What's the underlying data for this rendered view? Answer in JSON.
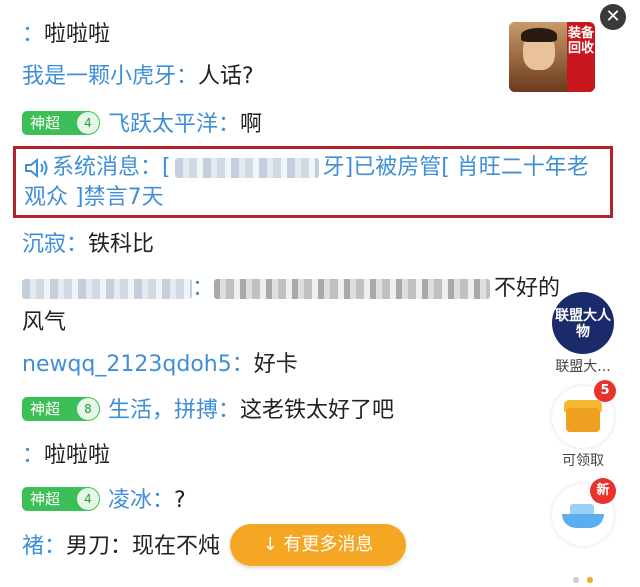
{
  "messages": [
    {
      "name": "",
      "text": "啦啦啦"
    },
    {
      "name": "我是一颗小虎牙",
      "text": "人话?"
    },
    {
      "badge": "神超",
      "level": "4",
      "name": "飞跃太平洋",
      "text": "啊"
    },
    {
      "name": "沉寂",
      "text": "铁科比"
    },
    {
      "text": "不好的风气"
    },
    {
      "name": "newqq_2123qdoh5",
      "text": "好卡"
    },
    {
      "badge": "神超",
      "level": "8",
      "name": "生活，拼搏",
      "text": "这老铁太好了吧"
    },
    {
      "name": "",
      "text": "啦啦啦"
    },
    {
      "badge": "神超",
      "level": "4",
      "name": "凌冰",
      "text": "?"
    },
    {
      "name": "褚",
      "text": "男刀：现在不炖"
    }
  ],
  "colon": "：",
  "system": {
    "label": "系统消息：",
    "open": "[",
    "partial": "牙",
    "body": "]已被房管[ 肖旺二十年老观众 ]禁言7天"
  },
  "gift_banner": {
    "tag": "装备回收"
  },
  "close_label": "✕",
  "side": [
    {
      "title": "联盟大人物",
      "label": "联盟大..."
    },
    {
      "label": "可领取",
      "count": "5"
    },
    {
      "badge": "新"
    }
  ],
  "more_button": "↓ 有更多消息",
  "colors": {
    "name": "#3f8fd6",
    "highlight_border": "#b3232b",
    "badge": "#3cbf56",
    "accent": "#f5a623"
  }
}
